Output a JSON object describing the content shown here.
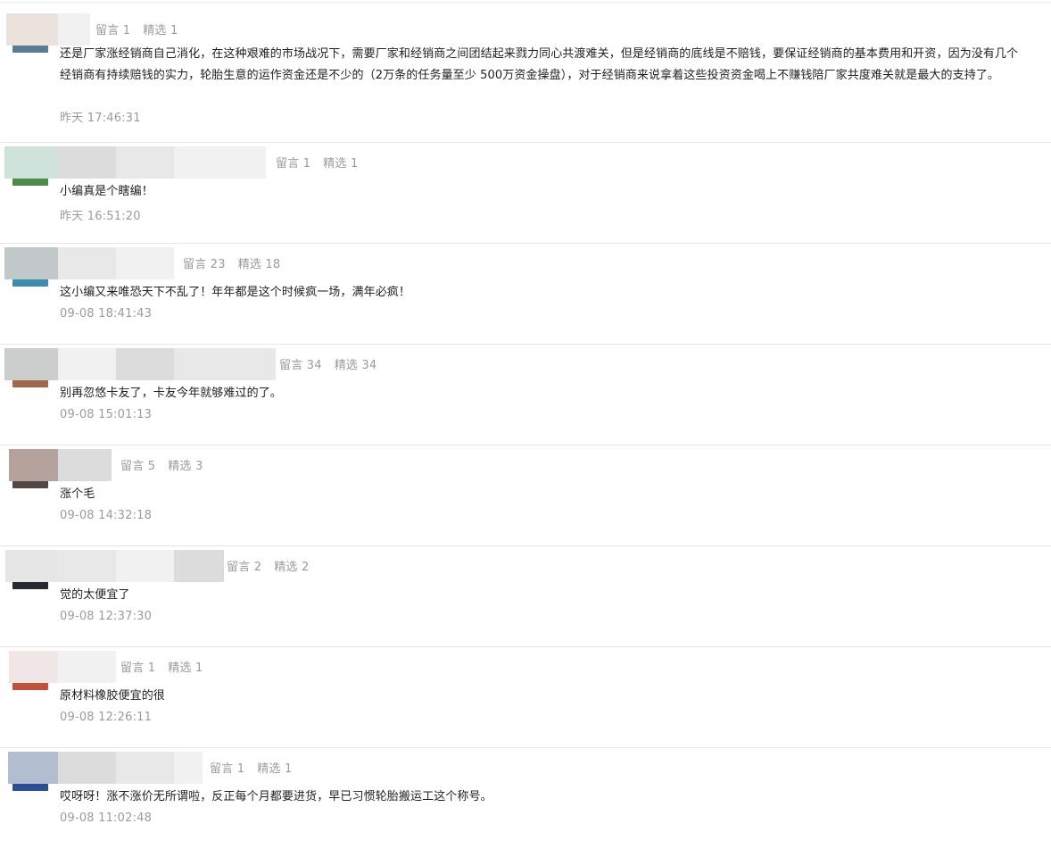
{
  "comments": [
    {
      "reply_count": "留言 1",
      "featured_count": "精选 1",
      "text": "还是厂家涨经销商自己消化，在这种艰难的市场战况下，需要厂家和经销商之间团结起来戮力同心共渡难关，但是经销商的底线是不赔钱，要保证经销商的基本费用和开资，因为没有几个经销商有持续赔钱的实力，轮胎生意的运作资金还是不少的（2万条的任务量至少 500万资金操盘），对于经销商来说拿着这些投资资金喝上不赚钱陪厂家共度难关就是最大的支持了。",
      "time": "昨天 17:46:31"
    },
    {
      "reply_count": "留言 1",
      "featured_count": "精选 1",
      "text": "小编真是个瞎编！",
      "time": "昨天 16:51:20"
    },
    {
      "reply_count": "留言 23",
      "featured_count": "精选 18",
      "text": "这小编又来唯恐天下不乱了！年年都是这个时候疯一场，满年必疯！",
      "time": "09-08 18:41:43"
    },
    {
      "reply_count": "留言 34",
      "featured_count": "精选 34",
      "text": "别再忽悠卡友了，卡友今年就够难过的了。",
      "time": "09-08 15:01:13"
    },
    {
      "reply_count": "留言 5",
      "featured_count": "精选 3",
      "text": "涨个毛",
      "time": "09-08 14:32:18"
    },
    {
      "reply_count": "留言 2",
      "featured_count": "精选 2",
      "text": "觉的太便宜了",
      "time": "09-08 12:37:30"
    },
    {
      "reply_count": "留言 1",
      "featured_count": "精选 1",
      "text": "原材料橡胶便宜的很",
      "time": "09-08 12:26:11"
    },
    {
      "reply_count": "留言 1",
      "featured_count": "精选 1",
      "text": "哎呀呀！涨不涨价无所谓啦，反正每个月都要进货，早已习惯轮胎搬运工这个称号。",
      "time": "09-08 11:02:48"
    }
  ],
  "colors": {
    "meta_text": "#9b9b9b",
    "body_text": "#1f1f1f",
    "separator": "#e6e6e6",
    "blur_segments": [
      "#e8e8e8",
      "#f1f1f1",
      "#dcdcdc"
    ],
    "avatar_tones": [
      "#ece2dc",
      "#cfe3da",
      "#c2c7ca",
      "#cacdcc",
      "#b5a29c",
      "#e6e6e6",
      "#f1e6e6",
      "#b3bdd0"
    ],
    "avatar_bottom_tones": [
      "#5a7b94",
      "#4f8a4a",
      "#3a8db0",
      "#a0684a",
      "#514846",
      "#262a30",
      "#c0503a",
      "#2b4f8f"
    ]
  }
}
